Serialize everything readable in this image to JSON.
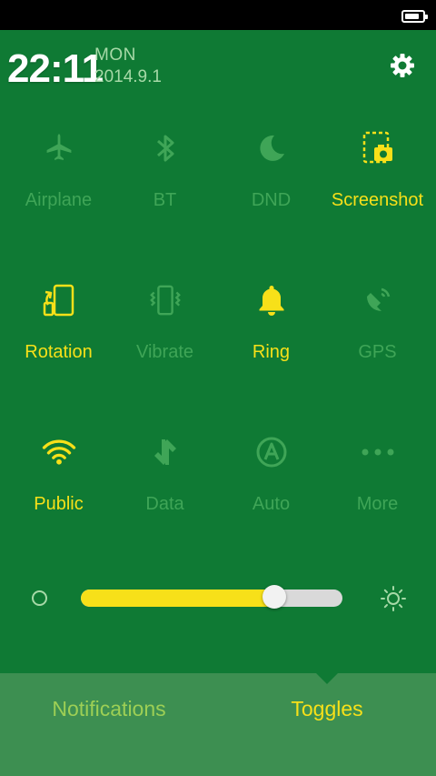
{
  "status": {
    "battery_level": 0.85
  },
  "header": {
    "time": "22:11",
    "day": "MON",
    "date": "2014.9.1"
  },
  "colors": {
    "panel": "#0f7a34",
    "active": "#f7e019",
    "inactive": "#3fa557",
    "tab_bar": "#3d8f51",
    "subtext": "#a6d9a7"
  },
  "toggles": [
    {
      "label": "Airplane",
      "icon": "airplane-icon",
      "active": false
    },
    {
      "label": "BT",
      "icon": "bluetooth-icon",
      "active": false
    },
    {
      "label": "DND",
      "icon": "moon-icon",
      "active": false
    },
    {
      "label": "Screenshot",
      "icon": "screenshot-icon",
      "active": true
    },
    {
      "label": "Rotation",
      "icon": "rotation-icon",
      "active": true
    },
    {
      "label": "Vibrate",
      "icon": "vibrate-icon",
      "active": false
    },
    {
      "label": "Ring",
      "icon": "bell-icon",
      "active": true
    },
    {
      "label": "GPS",
      "icon": "gps-icon",
      "active": false
    },
    {
      "label": "Public",
      "icon": "wifi-icon",
      "active": true
    },
    {
      "label": "Data",
      "icon": "data-icon",
      "active": false
    },
    {
      "label": "Auto",
      "icon": "auto-icon",
      "active": false
    },
    {
      "label": "More",
      "icon": "more-icon",
      "active": false
    }
  ],
  "brightness": {
    "level": 0.74
  },
  "tabs": [
    {
      "label": "Notifications",
      "selected": false
    },
    {
      "label": "Toggles",
      "selected": true
    }
  ]
}
